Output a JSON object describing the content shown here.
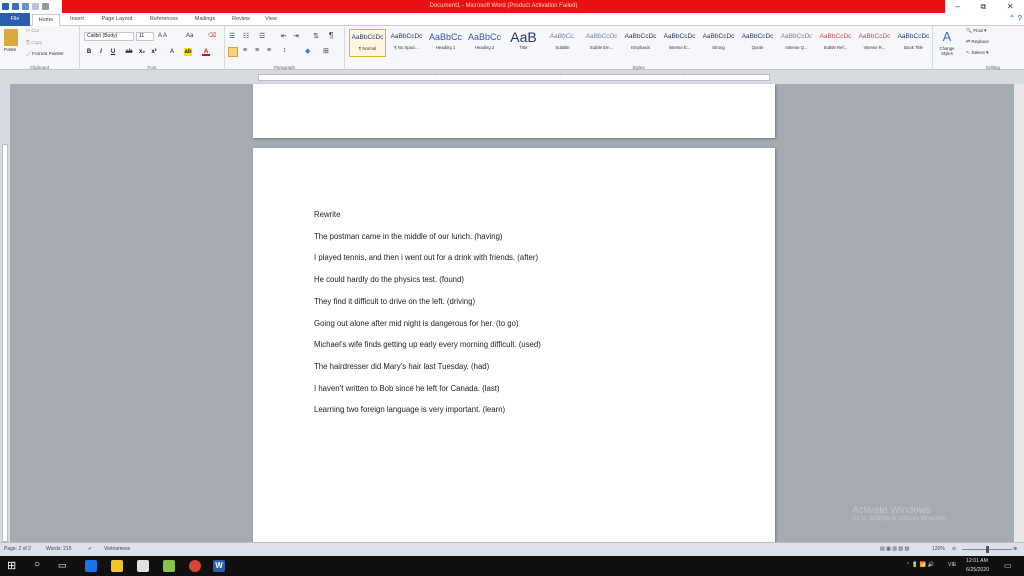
{
  "window": {
    "title": "Document1 - Microsoft Word (Product Activation Failed)",
    "minimize": "–",
    "restore": "⧉",
    "close": "✕"
  },
  "tabs": {
    "file": "File",
    "home": "Home",
    "insert": "Insert",
    "page_layout": "Page Layout",
    "references": "References",
    "mailings": "Mailings",
    "review": "Review",
    "view": "View"
  },
  "ribbon": {
    "clipboard": {
      "paste": "Paste",
      "cut": "Cut",
      "copy": "Copy",
      "format_painter": "Format Painter",
      "label": "Clipboard"
    },
    "font": {
      "name": "Calibri (Body)",
      "size": "11",
      "label": "Font"
    },
    "paragraph": {
      "label": "Paragraph"
    },
    "styles": {
      "label": "Styles",
      "items": [
        {
          "preview": "AaBbCcDc",
          "name": "¶ Normal"
        },
        {
          "preview": "AaBbCcDc",
          "name": "¶ No Spaci..."
        },
        {
          "preview": "AaBbCc",
          "name": "Heading 1"
        },
        {
          "preview": "AaBbCc",
          "name": "Heading 2"
        },
        {
          "preview": "AaB",
          "name": "Title"
        },
        {
          "preview": "AaBbCc.",
          "name": "Subtitle"
        },
        {
          "preview": "AaBbCcDc",
          "name": "Subtle Em..."
        },
        {
          "preview": "AaBbCcDc",
          "name": "Emphasis"
        },
        {
          "preview": "AaBbCcDc",
          "name": "Intense E..."
        },
        {
          "preview": "AaBbCcDc",
          "name": "Strong"
        },
        {
          "preview": "AaBbCcDc",
          "name": "Quote"
        },
        {
          "preview": "AaBbCcDc",
          "name": "Intense Q..."
        },
        {
          "preview": "AaBbCcDc",
          "name": "Subtle Ref..."
        },
        {
          "preview": "AaBbCcDc",
          "name": "Intense R..."
        },
        {
          "preview": "AaBbCcDc",
          "name": "Book Title"
        }
      ],
      "change_styles": "Change Styles"
    },
    "editing": {
      "find": "Find",
      "replace": "Replace",
      "select": "Select",
      "label": "Editing"
    }
  },
  "document": {
    "lines": [
      "Rewrite",
      "The postman came in the middle of our lunch. (having)",
      "I played tennis, and then i went out for a drink with friends. (after)",
      "He could hardly do the physics test. (found)",
      "They find it difficult to drive on the left. (driving)",
      "Going out alone after mid night is dangerous for her. (to go)",
      "Michael’s wife finds getting up early every morning difficult. (used)",
      "The hairdresser did Mary’s hair last Tuesday. (had)",
      "I haven’t written to Bob since he left for Canada. (last)",
      "Learning two foreign language is very important. (learn)"
    ]
  },
  "watermark": {
    "line1": "Activate Windows",
    "line2": "Go to Settings to activate Windows."
  },
  "status": {
    "page": "Page: 2 of 2",
    "words": "Words: 215",
    "language": "Vietnamese",
    "zoom": "120%"
  },
  "taskbar": {
    "time": "12:01 AM",
    "date": "6/25/2020",
    "lang": "VIE"
  },
  "colors": {
    "title_bar": "#e81010",
    "file_tab": "#2a5db0",
    "taskbar": "#101010"
  }
}
